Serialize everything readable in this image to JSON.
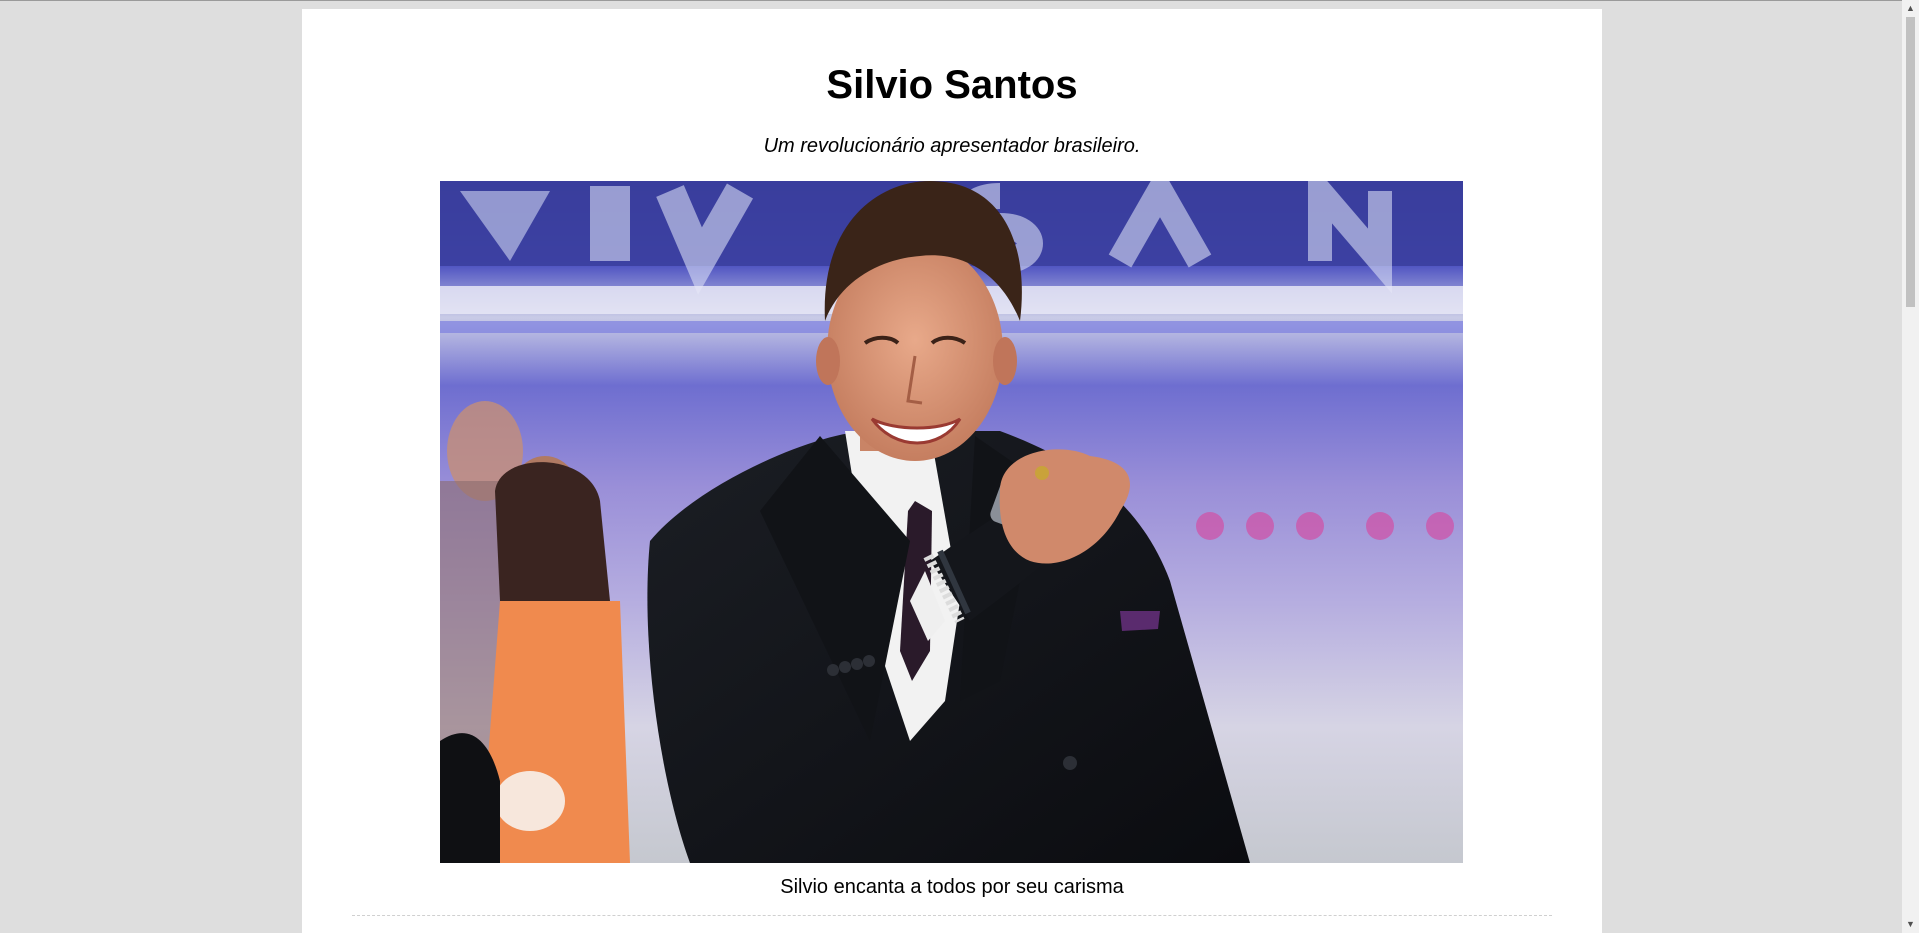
{
  "header": {
    "title": "Silvio Santos",
    "subtitle": "Um revolucionário apresentador brasileiro."
  },
  "figure": {
    "caption": "Silvio encanta a todos por seu carisma",
    "image_description": "photo-silvio-santos"
  },
  "scrollbar": {
    "up_icon": "▲",
    "down_icon": "▼"
  },
  "colors": {
    "page_background": "#dedede",
    "content_background": "#ffffff",
    "text": "#000000"
  }
}
